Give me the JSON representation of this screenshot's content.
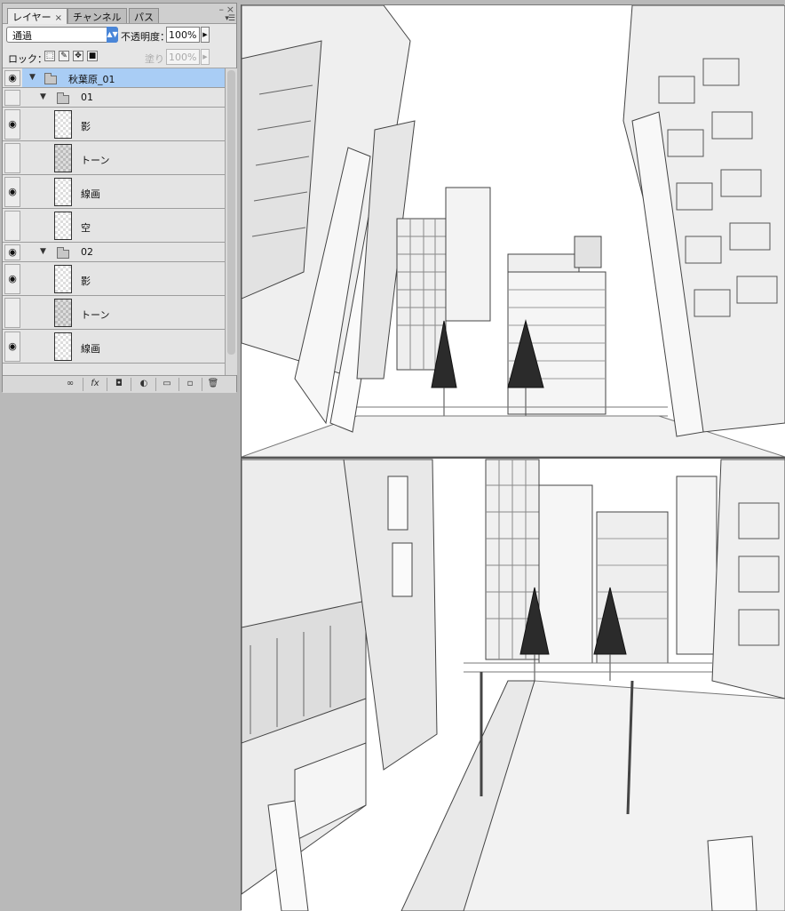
{
  "panel": {
    "tabs": [
      {
        "label": "レイヤー",
        "close": "×"
      },
      {
        "label": "チャンネル"
      },
      {
        "label": "パス"
      }
    ],
    "blend_mode": "通過",
    "opacity_label": "不透明度：",
    "opacity_value": "100%",
    "lock_label": "ロック：",
    "fill_label": "塗り：",
    "fill_value": "100%"
  },
  "layers": [
    {
      "name": "秋葉原_01",
      "type": "group",
      "level": 0,
      "visible": true,
      "selected": true
    },
    {
      "name": "01",
      "type": "group",
      "level": 1,
      "visible": false
    },
    {
      "name": "影",
      "type": "layer",
      "level": 2,
      "visible": true
    },
    {
      "name": "トーン",
      "type": "layer",
      "level": 2,
      "visible": false
    },
    {
      "name": "線画",
      "type": "layer",
      "level": 2,
      "visible": true
    },
    {
      "name": "空",
      "type": "layer",
      "level": 2,
      "visible": false
    },
    {
      "name": "02",
      "type": "group",
      "level": 1,
      "visible": true
    },
    {
      "name": "影",
      "type": "layer",
      "level": 2,
      "visible": true
    },
    {
      "name": "トーン",
      "type": "layer",
      "level": 2,
      "visible": false
    },
    {
      "name": "線画",
      "type": "layer",
      "level": 2,
      "visible": true
    }
  ],
  "bottom_buttons": {
    "link": "∞",
    "fx": "fx",
    "mask": "◘",
    "adjustment": "◐",
    "new_group": "▭",
    "new_layer": "▫",
    "delete": "🗑"
  },
  "icons": {
    "eye": "eye-icon",
    "folder": "folder-icon",
    "panel_menu": "panel-menu-icon"
  },
  "colors": {
    "selection": "#a9cdf5",
    "accent": "#4a86d8"
  }
}
